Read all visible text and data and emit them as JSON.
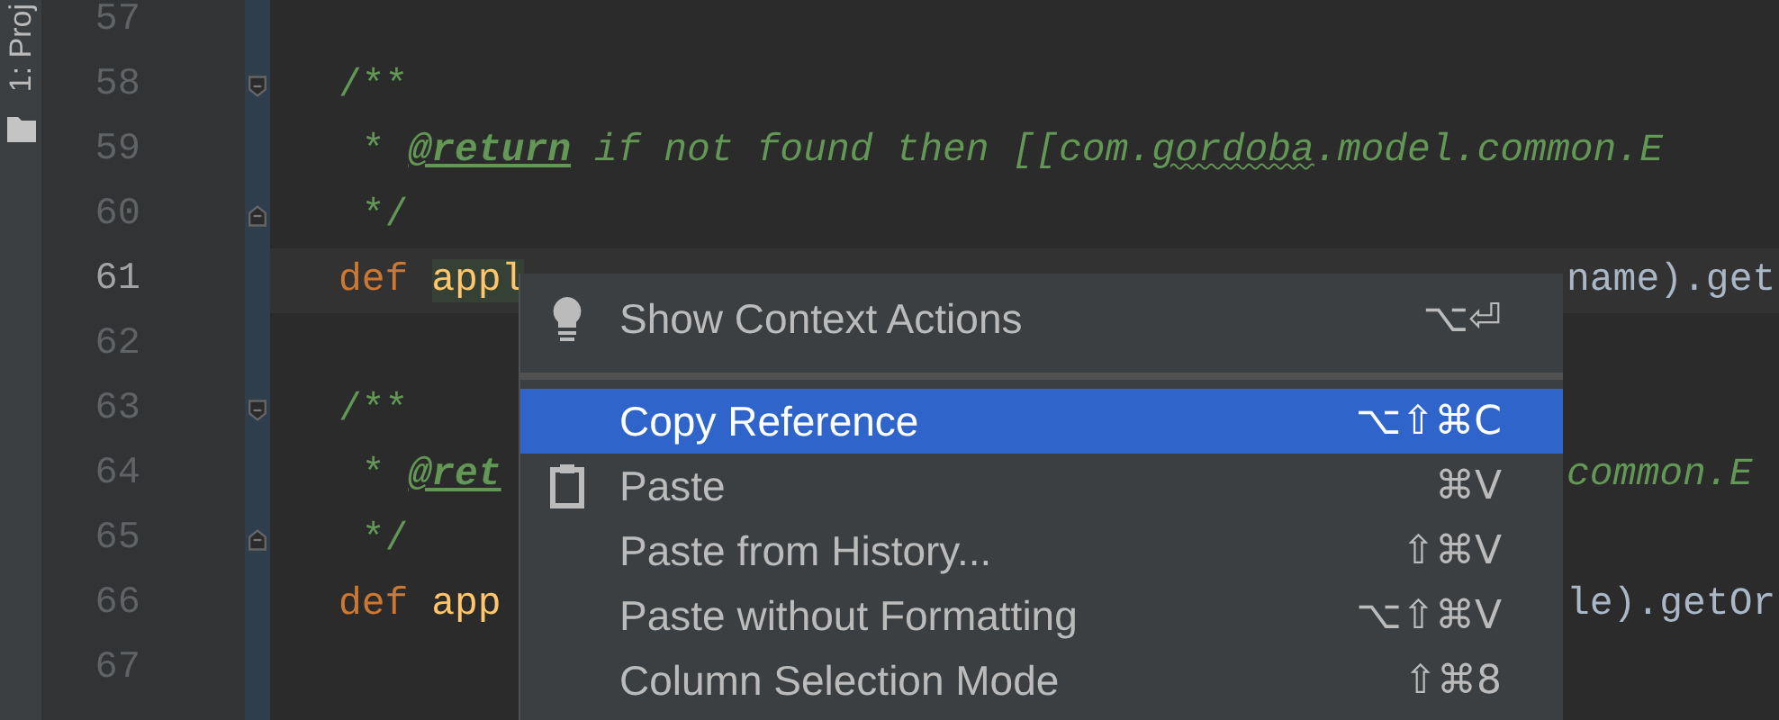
{
  "tool_strip": {
    "tab": "1: Proj"
  },
  "editor": {
    "lines": [
      {
        "number": "57",
        "kind": "plain",
        "current": false
      },
      {
        "number": "58",
        "kind": "fold_start",
        "current": false,
        "head": [
          {
            "kind": "comment",
            "text": "/**"
          }
        ]
      },
      {
        "number": "59",
        "kind": "plain",
        "current": false,
        "head": [
          {
            "kind": "comment",
            "text": " * "
          },
          {
            "kind": "tag",
            "text": "@return"
          },
          {
            "kind": "italic",
            "text": " if not found then [[com."
          },
          {
            "kind": "typo",
            "text": "gordoba"
          },
          {
            "kind": "italic",
            "text": ".model.common.E"
          }
        ]
      },
      {
        "number": "60",
        "kind": "fold_end",
        "current": false,
        "head": [
          {
            "kind": "comment",
            "text": " */"
          }
        ]
      },
      {
        "number": "61",
        "kind": "plain",
        "current": true,
        "head": [
          {
            "kind": "keyword",
            "text": "def"
          },
          {
            "kind": "fn",
            "text": "appl",
            "highlighted": true
          }
        ],
        "tail": [
          {
            "kind": "plain",
            "text": "name).get"
          }
        ]
      },
      {
        "number": "62",
        "kind": "plain",
        "current": false
      },
      {
        "number": "63",
        "kind": "fold_start",
        "current": false,
        "head": [
          {
            "kind": "comment",
            "text": "/**"
          }
        ]
      },
      {
        "number": "64",
        "kind": "plain",
        "current": false,
        "head": [
          {
            "kind": "comment",
            "text": " * "
          },
          {
            "kind": "tag",
            "text": "@ret"
          }
        ],
        "tail": [
          {
            "kind": "italic",
            "text": "common.E"
          }
        ]
      },
      {
        "number": "65",
        "kind": "fold_end",
        "current": false,
        "head": [
          {
            "kind": "comment",
            "text": " */"
          }
        ]
      },
      {
        "number": "66",
        "kind": "plain",
        "current": false,
        "head": [
          {
            "kind": "keyword",
            "text": "def"
          },
          {
            "kind": "fn",
            "text": "app",
            "highlighted": false
          }
        ],
        "tail": [
          {
            "kind": "plain",
            "text": "le).getOr"
          }
        ]
      },
      {
        "number": "67",
        "kind": "plain",
        "current": false
      }
    ]
  },
  "context_menu": {
    "items": [
      {
        "kind": "bulb",
        "label": "Show Context Actions",
        "shortcut": "⌥⏎",
        "selected": false
      },
      {
        "kind": "separator"
      },
      {
        "kind": "plain",
        "label": "Copy Reference",
        "shortcut": "⌥⇧⌘C",
        "selected": true
      },
      {
        "kind": "clipboard",
        "label": "Paste",
        "shortcut": "⌘V",
        "selected": false
      },
      {
        "kind": "plain",
        "label": "Paste from History...",
        "shortcut": "⇧⌘V",
        "selected": false
      },
      {
        "kind": "plain",
        "label": "Paste without Formatting",
        "shortcut": "⌥⇧⌘V",
        "selected": false
      },
      {
        "kind": "plain",
        "label": "Column Selection Mode",
        "shortcut": "⇧⌘8",
        "selected": false
      }
    ]
  }
}
